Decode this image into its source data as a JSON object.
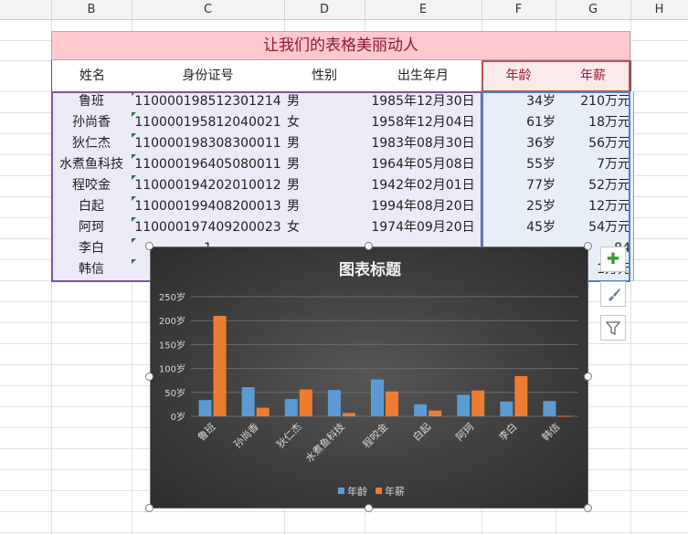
{
  "columns": [
    "B",
    "C",
    "D",
    "E",
    "F",
    "G",
    "H"
  ],
  "table": {
    "title": "让我们的表格美丽动人",
    "headers": [
      "姓名",
      "身份证号",
      "性别",
      "出生年月",
      "年龄",
      "年薪"
    ],
    "rows": [
      [
        "鲁班",
        "110000198512301214",
        "男",
        "1985年12月30日",
        "34岁",
        "210万元"
      ],
      [
        "孙尚香",
        "110000195812040021",
        "女",
        "1958年12月04日",
        "61岁",
        "18万元"
      ],
      [
        "狄仁杰",
        "110000198308300011",
        "男",
        "1983年08月30日",
        "36岁",
        "56万元"
      ],
      [
        "水煮鱼科技",
        "110000196405080011",
        "男",
        "1964年05月08日",
        "55岁",
        "7万元"
      ],
      [
        "程咬金",
        "110000194202010012",
        "男",
        "1942年02月01日",
        "77岁",
        "52万元"
      ],
      [
        "白起",
        "110000199408200013",
        "男",
        "1994年08月20日",
        "25岁",
        "12万元"
      ],
      [
        "阿珂",
        "110000197409200023",
        "女",
        "1974年09月20日",
        "45岁",
        "54万元"
      ],
      [
        "李白",
        "1",
        "",
        "",
        "",
        "84"
      ],
      [
        "韩信",
        "1",
        "",
        "",
        "",
        "1万元"
      ]
    ]
  },
  "chart_data": {
    "type": "bar",
    "title": "图表标题",
    "categories": [
      "鲁班",
      "孙尚香",
      "狄仁杰",
      "水煮鱼科技",
      "程咬金",
      "白起",
      "阿珂",
      "李白",
      "韩信"
    ],
    "series": [
      {
        "name": "年龄",
        "values": [
          34,
          61,
          36,
          55,
          77,
          25,
          45,
          31,
          32
        ],
        "color": "#5b9bd5"
      },
      {
        "name": "年薪",
        "values": [
          210,
          18,
          56,
          7,
          52,
          12,
          54,
          84,
          1
        ],
        "color": "#ed7d31"
      }
    ],
    "ylim": [
      0,
      250
    ],
    "ytick_values": [
      0,
      50,
      100,
      150,
      200,
      250
    ],
    "ytick_labels": [
      "0岁",
      "50岁",
      "100岁",
      "150岁",
      "200岁",
      "250岁"
    ],
    "xlabel": "",
    "ylabel": "",
    "legend": "bottom",
    "grid": true
  },
  "side_buttons": [
    {
      "icon": "plus-icon",
      "glyph": "✚"
    },
    {
      "icon": "brush-icon",
      "glyph": "🖌"
    },
    {
      "icon": "filter-icon",
      "glyph": "⛉"
    }
  ]
}
